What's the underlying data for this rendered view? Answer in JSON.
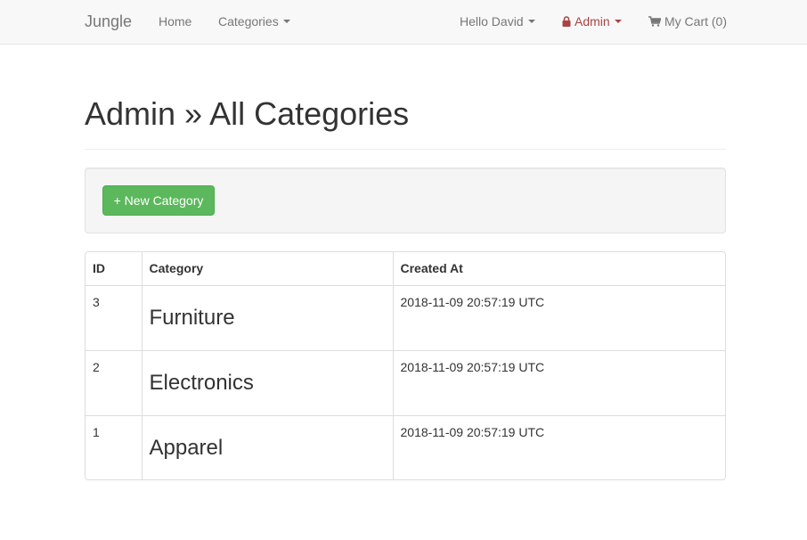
{
  "navbar": {
    "brand": "Jungle",
    "home": "Home",
    "categories": "Categories",
    "hello": "Hello David",
    "admin": "Admin",
    "cart": "My Cart (0)"
  },
  "page": {
    "title": "Admin » All Categories",
    "new_button": "+ New Category"
  },
  "table": {
    "headers": [
      "ID",
      "Category",
      "Created At"
    ],
    "rows": [
      {
        "id": "3",
        "category": "Furniture",
        "created_at": "2018-11-09 20:57:19 UTC"
      },
      {
        "id": "2",
        "category": "Electronics",
        "created_at": "2018-11-09 20:57:19 UTC"
      },
      {
        "id": "1",
        "category": "Apparel",
        "created_at": "2018-11-09 20:57:19 UTC"
      }
    ]
  },
  "icons": {
    "admin": "lock-icon",
    "cart": "shopping-cart-icon",
    "dropdown": "caret-down-icon"
  },
  "colors": {
    "navbar_bg": "#f8f8f8",
    "admin_link": "#a94442",
    "success_button": "#5cb85c"
  }
}
